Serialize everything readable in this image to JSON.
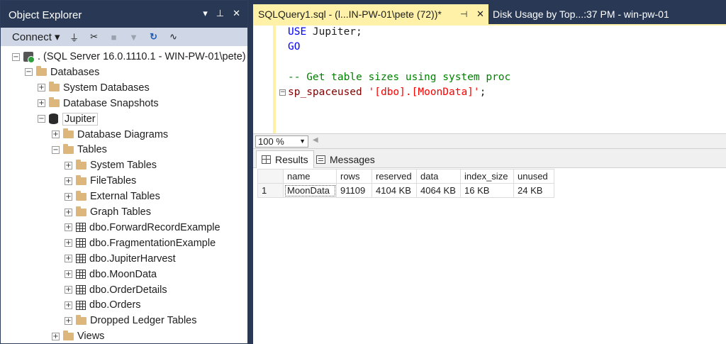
{
  "object_explorer": {
    "title": "Object Explorer",
    "title_buttons": [
      "▾",
      "⊥",
      "✕"
    ],
    "toolbar": {
      "connect_label": "Connect ▾"
    },
    "tree": [
      {
        "label": ". (SQL Server 16.0.1110.1 - WIN-PW-01\\pete)",
        "icon": "server-icon",
        "expander": "⊟"
      },
      {
        "label": "Databases",
        "icon": "folder-icon",
        "expander": "⊟"
      },
      {
        "label": "System Databases",
        "icon": "folder-icon",
        "expander": "⊞"
      },
      {
        "label": "Database Snapshots",
        "icon": "folder-icon",
        "expander": "⊞"
      },
      {
        "label": "Jupiter",
        "icon": "database-icon",
        "expander": "⊟"
      },
      {
        "label": "Database Diagrams",
        "icon": "folder-icon",
        "expander": "⊞"
      },
      {
        "label": "Tables",
        "icon": "folder-icon",
        "expander": "⊟"
      },
      {
        "label": "System Tables",
        "icon": "folder-icon",
        "expander": "⊞"
      },
      {
        "label": "FileTables",
        "icon": "folder-icon",
        "expander": "⊞"
      },
      {
        "label": "External Tables",
        "icon": "folder-icon",
        "expander": "⊞"
      },
      {
        "label": "Graph Tables",
        "icon": "folder-icon",
        "expander": "⊞"
      },
      {
        "label": "dbo.ForwardRecordExample",
        "icon": "table-icon",
        "expander": "⊞"
      },
      {
        "label": "dbo.FragmentationExample",
        "icon": "table-icon",
        "expander": "⊞"
      },
      {
        "label": "dbo.JupiterHarvest",
        "icon": "table-icon",
        "expander": "⊞"
      },
      {
        "label": "dbo.MoonData",
        "icon": "table-icon",
        "expander": "⊞"
      },
      {
        "label": "dbo.OrderDetails",
        "icon": "table-icon",
        "expander": "⊞"
      },
      {
        "label": "dbo.Orders",
        "icon": "table-icon",
        "expander": "⊞"
      },
      {
        "label": "Dropped Ledger Tables",
        "icon": "folder-icon",
        "expander": "⊞"
      },
      {
        "label": "Views",
        "icon": "folder-icon",
        "expander": "⊞"
      }
    ]
  },
  "tabs": {
    "active": "SQLQuery1.sql - (l...IN-PW-01\\pete (72))*",
    "second": "Disk Usage by Top...:37 PM - win-pw-01"
  },
  "editor": {
    "line1_kw": "USE",
    "line1_rest": " Jupiter;",
    "line2_kw": "GO",
    "line4_comment": "-- Get table sizes using system proc",
    "line5_fn": "sp_spaceused",
    "line5_str": "'[dbo].[MoonData]'",
    "line5_end": ";"
  },
  "zoom": {
    "value": "100 %"
  },
  "results": {
    "tab_results": "Results",
    "tab_messages": "Messages",
    "columns": [
      "name",
      "rows",
      "reserved",
      "data",
      "index_size",
      "unused"
    ],
    "rows": [
      {
        "num": "1",
        "cells": [
          "MoonData",
          "91109",
          "4104 KB",
          "4064 KB",
          "16 KB",
          "24 KB"
        ]
      }
    ]
  },
  "colors": {
    "chrome": "#293955",
    "active_tab": "#fff1a8",
    "keyword": "#0000ff",
    "comment": "#008000",
    "string": "#ff0000",
    "proc": "#800000"
  }
}
